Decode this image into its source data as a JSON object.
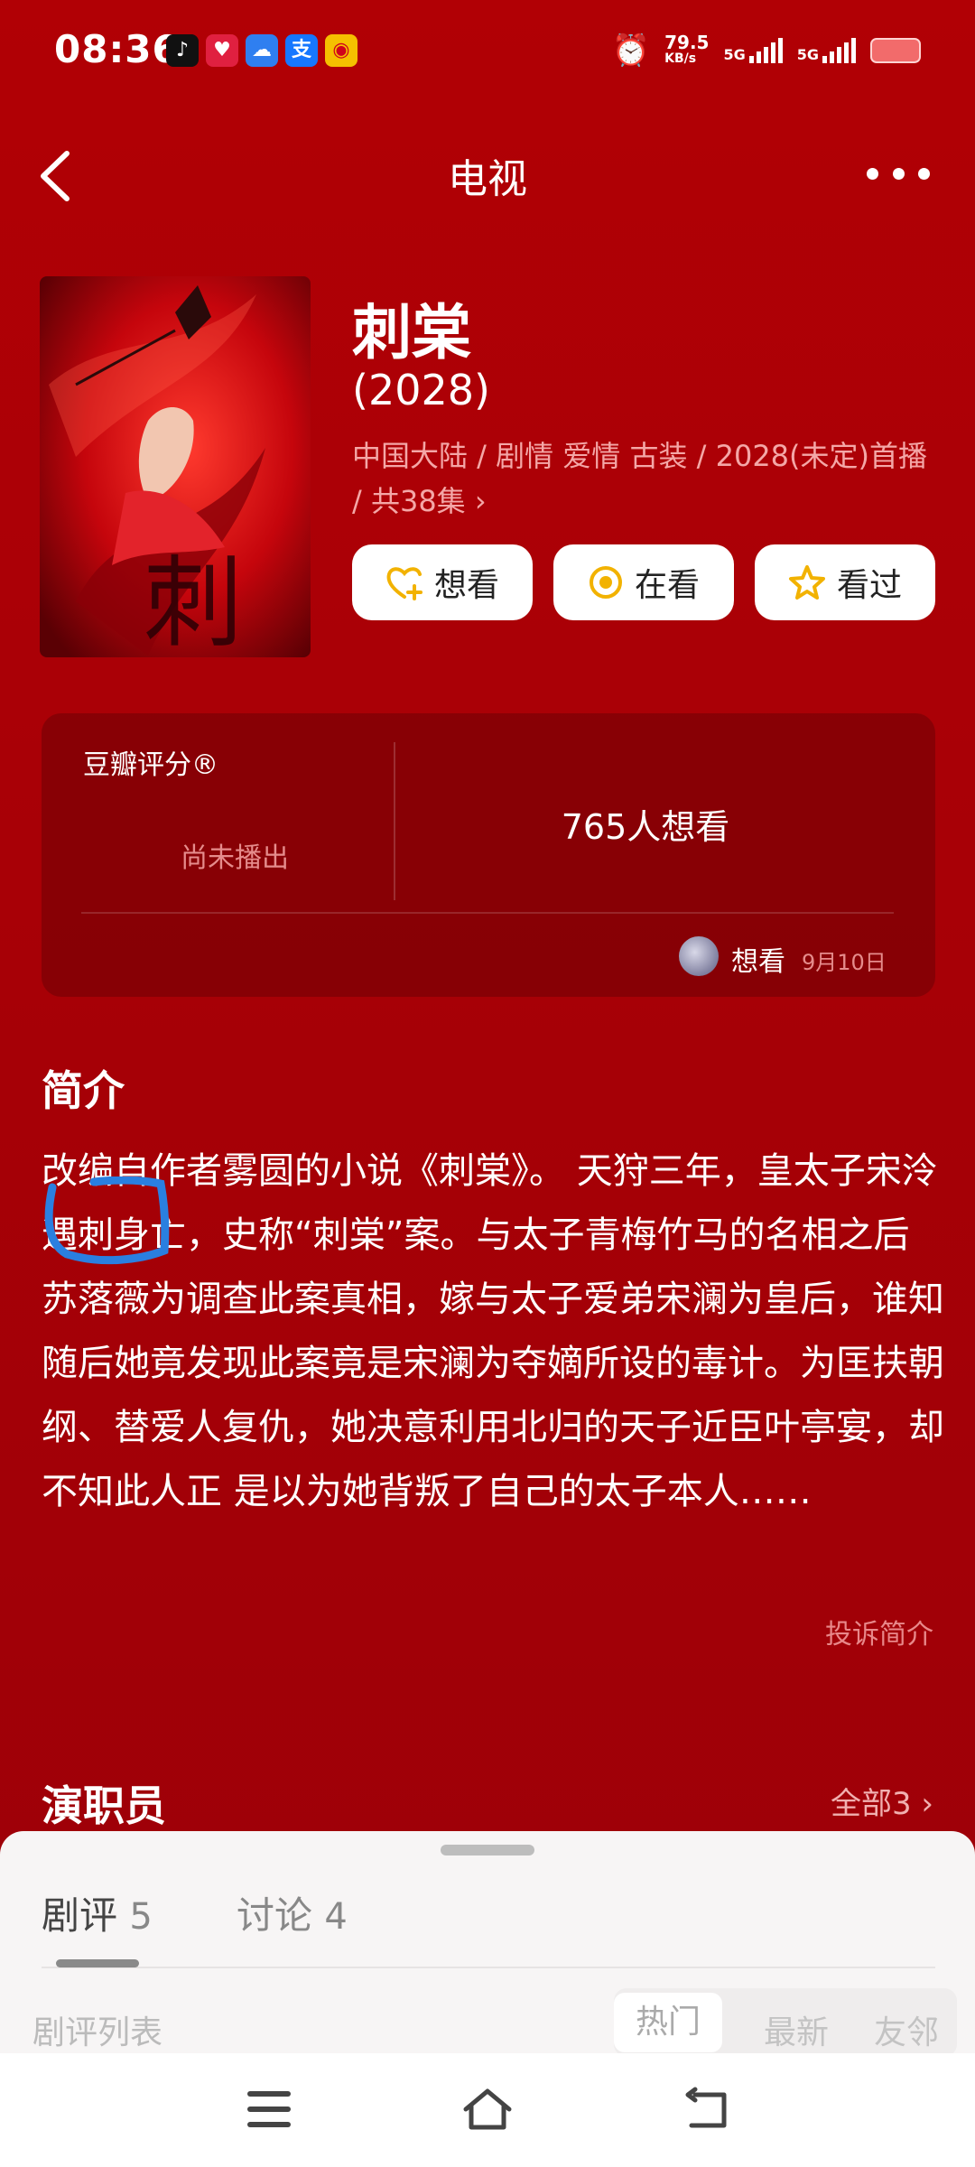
{
  "status_bar": {
    "time": "08:36",
    "apps": [
      "tiktok-icon",
      "heart-app-icon",
      "cloud-app-icon",
      "alipay-icon",
      "weibo-icon"
    ],
    "alipay_glyph": "支",
    "speed_value": "79.5",
    "speed_unit": "KB/s",
    "net1": "5G",
    "net2": "5G"
  },
  "nav": {
    "title": "电视"
  },
  "show": {
    "title": "刺棠",
    "year": "(2028)",
    "meta": "中国大陆 / 剧情 爱情 古装 / 2028(未定)首播 / 共38集 ›"
  },
  "actions": {
    "want": "想看",
    "watching": "在看",
    "watched": "看过"
  },
  "rating": {
    "label": "豆瓣评分®",
    "status": "尚未播出",
    "want_count": "765人想看",
    "user_action": "想看",
    "user_date": "9月10日"
  },
  "intro": {
    "heading": "简介",
    "text": "改编自作者雾圆的小说《刺棠》。 天狩三年，皇太子宋泠遇刺身亡，史称“刺棠”案。与太子青梅竹马的名相之后苏落薇为调查此案真相，嫁与太子爱弟宋澜为皇后，谁知随后她竟发现此案竟是宋澜为夺嫡所设的毒计。为匡扶朝纲、替爱人复仇，她决意利用北归的天子近臣叶亭宴，却不知此人正 是以为她背叛了自己的太子本人……",
    "report": "投诉简介"
  },
  "cast": {
    "heading": "演职员",
    "all": "全部3 ›"
  },
  "sheet": {
    "tab_reviews": "剧评",
    "tab_reviews_count": "5",
    "tab_discuss": "讨论",
    "tab_discuss_count": "4",
    "list_label": "剧评列表",
    "sort_hot": "热门",
    "sort_new": "最新",
    "sort_friends": "友邻"
  },
  "colors": {
    "background": "#a80006",
    "accent_yellow": "#f2b200",
    "highlight_blue": "#2a7fe0"
  }
}
